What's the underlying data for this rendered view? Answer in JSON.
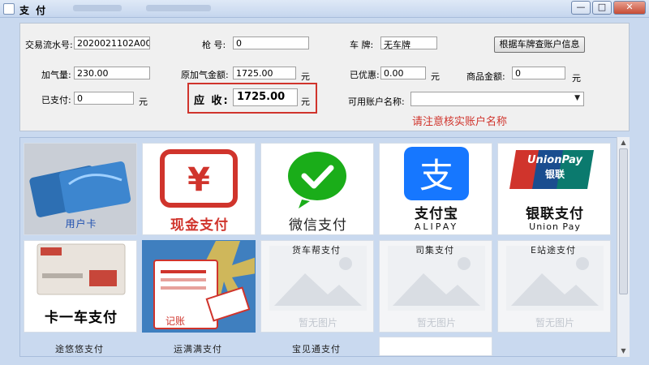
{
  "window": {
    "title": "支 付",
    "minimize": "—",
    "maximize": "□",
    "close": "✕"
  },
  "form": {
    "serial_label": "交易流水号:",
    "serial_value": "2020021102A00",
    "gun_label": "枪 号:",
    "gun_value": "0",
    "plate_label": "车 牌:",
    "plate_value": "无车牌",
    "query_button": "根据车牌查账户信息",
    "gas_label": "加气量:",
    "gas_value": "230.00",
    "orig_amount_label": "原加气金额:",
    "orig_amount_value": "1725.00",
    "orig_amount_unit": "元",
    "discount_label": "已优惠:",
    "discount_value": "0.00",
    "discount_unit": "元",
    "goods_label": "商品金额:",
    "goods_value": "0",
    "goods_unit": "元",
    "paid_label": "已支付:",
    "paid_value": "0",
    "paid_unit": "元",
    "due_label": "应 收:",
    "due_value": "1725.00",
    "due_unit": "元",
    "account_label": "可用账户名称:",
    "account_value": "",
    "warning": "请注意核实账户名称"
  },
  "payments": [
    {
      "caption": "用户卡"
    },
    {
      "caption": "现金支付"
    },
    {
      "caption": "微信支付"
    },
    {
      "caption": "支付宝",
      "sub": "ALIPAY"
    },
    {
      "caption": "银联支付",
      "brand": "UnionPay",
      "brand_cn": "银联",
      "sub": "Union Pay"
    },
    {
      "caption": "卡一车支付",
      "label": "货车帮支付"
    },
    {
      "caption": "记账",
      "label": "司集支付"
    },
    {
      "placeholder": "暂无图片",
      "label": "E站途支付"
    },
    {
      "placeholder": "暂无图片",
      "label": "途悠悠支付"
    },
    {
      "placeholder": "暂无图片",
      "label": "运满满支付"
    },
    {
      "placeholder": "暂无图片",
      "label": "宝见通支付"
    }
  ],
  "colors": {
    "accent_red": "#d0342c",
    "wechat_green": "#1aad19",
    "alipay_blue": "#1677ff"
  }
}
